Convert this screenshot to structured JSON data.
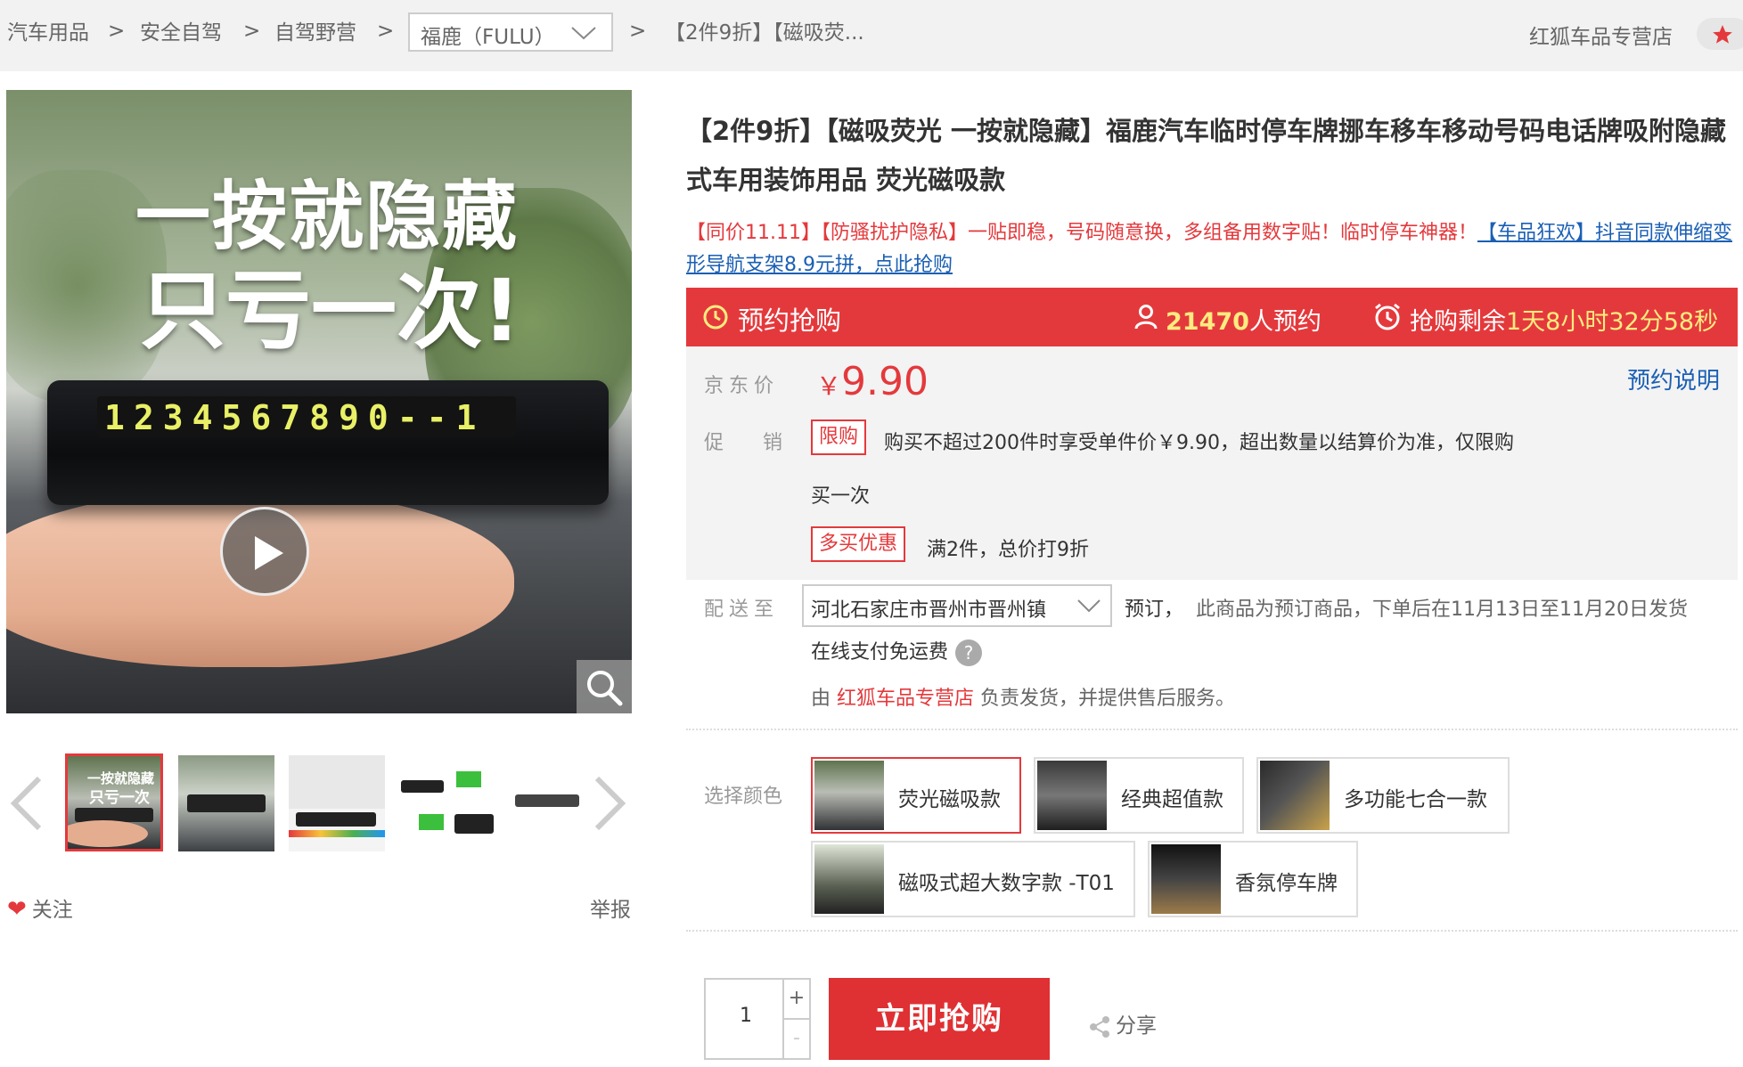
{
  "breadcrumb": {
    "items": [
      "汽车用品",
      "安全自驾",
      "自驾野营"
    ],
    "separator": ">",
    "brand": "福鹿（FULU）",
    "current": "【2件9折】【磁吸荧..."
  },
  "header": {
    "shop_name": "红狐车品专营店"
  },
  "gallery": {
    "promo_line1": "一按就隐藏",
    "promo_line2": "只亏一次!",
    "plate_digits": "1234567890--1",
    "thumb1_line1": "一按就隐藏",
    "thumb1_line2": "只亏一次"
  },
  "actions": {
    "follow": "关注",
    "report": "举报"
  },
  "product": {
    "title": "【2件9折】【磁吸荧光 一按就隐藏】福鹿汽车临时停车牌挪车移车移动号码电话牌吸附隐藏式车用装饰用品 荧光磁吸款",
    "subtitle_red": "【同价11.11】【防骚扰护隐私】一贴即稳，号码随意换，多组备用数字贴！临时停车神器！",
    "subtitle_link": "【车品狂欢】抖音同款伸缩变形导航支架8.9元拼，点此抢购"
  },
  "rush": {
    "label": "预约抢购",
    "reserved_count": "21470",
    "reserved_suffix": "人预约",
    "timer_prefix": "抢购剩余",
    "timer_value": "1天8小时32分58秒"
  },
  "price": {
    "label": "京东价",
    "currency": "￥",
    "value": "9.90",
    "note_link": "预约说明"
  },
  "promotion": {
    "label": "促销",
    "tag1": "限购",
    "text1_line1": "购买不超过200件时享受单件价￥9.90，超出数量以结算价为准，仅限购",
    "text1_line2": "买一次",
    "tag2": "多买优惠",
    "text2": "满2件，总价打9折"
  },
  "shipping": {
    "label": "配送至",
    "address": "河北石家庄市晋州市晋州镇",
    "presale": "预订，",
    "presale_note": "此商品为预订商品，下单后在11月13日至11月20日发货",
    "freeship": "在线支付免运费",
    "seller_prefix": "由",
    "seller_shop": "红狐车品专营店",
    "seller_suffix": "负责发货，并提供售后服务。"
  },
  "color": {
    "label": "选择颜色",
    "options": [
      "荧光磁吸款",
      "经典超值款",
      "多功能七合一款",
      "磁吸式超大数字款 -T01",
      "香氛停车牌"
    ]
  },
  "purchase": {
    "quantity": "1",
    "plus": "+",
    "minus": "-",
    "buy_label": "立即抢购",
    "share_label": "分享"
  },
  "colors": {
    "accent": "#e4393c",
    "link": "#1a5fb4",
    "highlight": "#ffec80"
  }
}
